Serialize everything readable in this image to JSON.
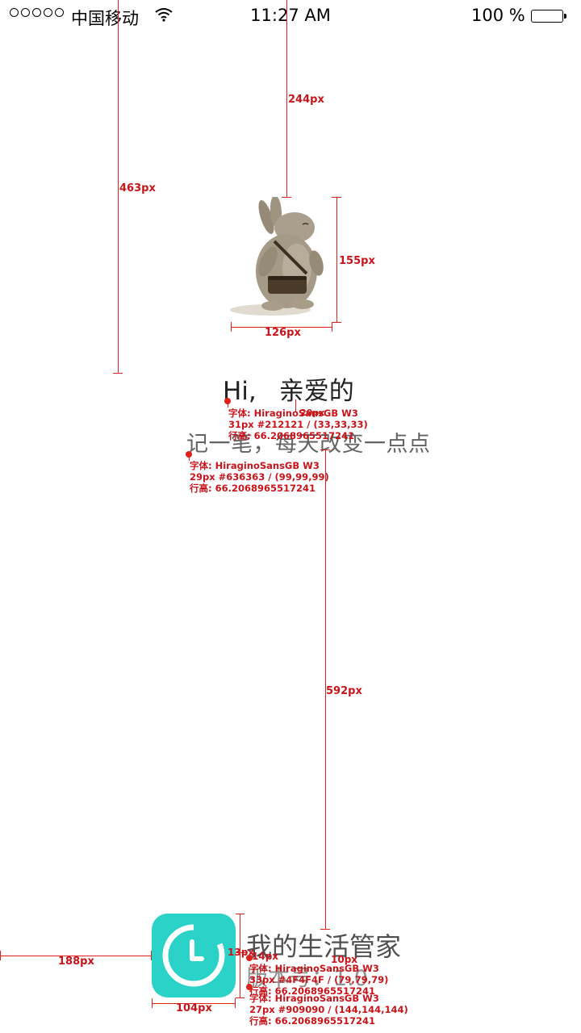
{
  "status_bar": {
    "carrier": "中国移动",
    "time": "11:27 AM",
    "battery": "100 %"
  },
  "content": {
    "greeting_hi": "Hi,",
    "greeting_name": "亲爱的",
    "slogan": "记一笔，每天改变一点点",
    "app_name": "我的生活管家",
    "app_version": "版本号：1.0"
  },
  "annotations": {
    "dims": {
      "d244": "244px",
      "d463": "463px",
      "d155": "155px",
      "d126": "126px",
      "d592": "592px",
      "d188": "188px",
      "d104": "104px",
      "d13": "13px",
      "d14": "14px",
      "d10": "10px",
      "d20": "20px"
    },
    "specs": {
      "greeting": {
        "line1": "字体: HiraginoSansGB W3",
        "line2": "31px #212121 / (33,33,33)",
        "line3": "行高: 66.2068965517241"
      },
      "slogan": {
        "line1": "字体: HiraginoSansGB W3",
        "line2": "29px #636363 / (99,99,99)",
        "line3": "行高: 66.2068965517241"
      },
      "app_name": {
        "line1": "字体: HiraginoSansGB W3",
        "line2": "33px #4F4F4F / (79,79,79)",
        "line3": "行高: 66.2068965517241"
      },
      "app_version": {
        "line1": "字体: HiraginoSansGB W3",
        "line2": "27px #909090 / (144,144,144)",
        "line3": "行高: 66.2068965517241"
      }
    }
  },
  "colors": {
    "accent": "#2bd2c8",
    "annotation": "#e0201a"
  }
}
